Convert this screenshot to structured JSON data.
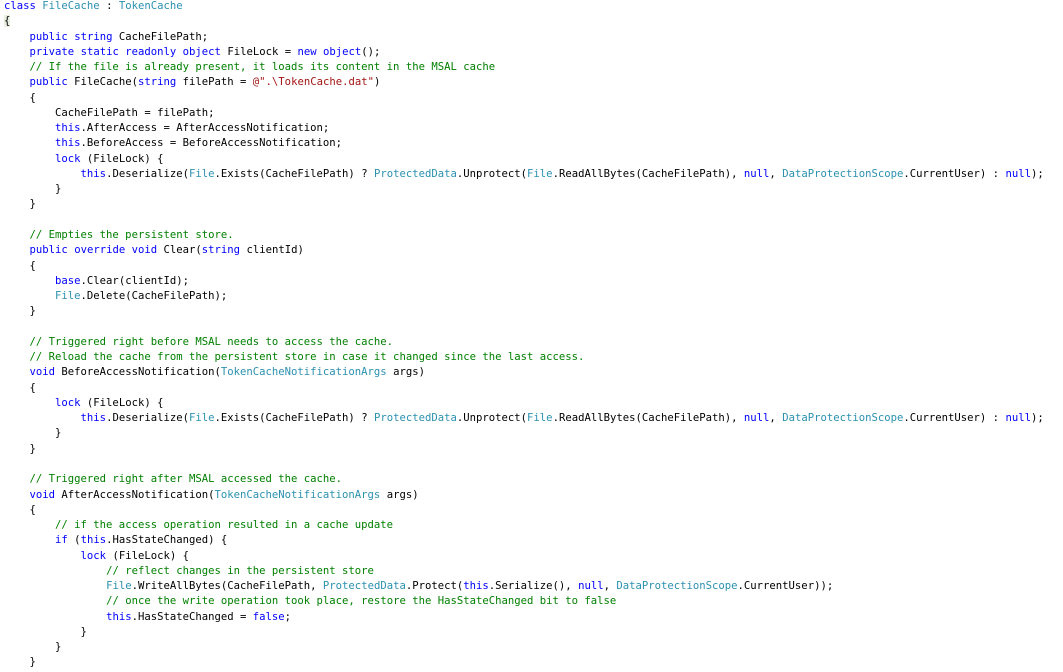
{
  "colors": {
    "keyword": "#0000ff",
    "type": "#2b91af",
    "comment": "#008000",
    "string": "#a31515",
    "text": "#000000"
  },
  "code": {
    "lines": [
      [
        [
          "kw",
          "class"
        ],
        [
          "p",
          " "
        ],
        [
          "type",
          "FileCache"
        ],
        [
          "p",
          " : "
        ],
        [
          "type",
          "TokenCache"
        ]
      ],
      [
        [
          "p",
          "{"
        ]
      ],
      [
        [
          "p",
          "    "
        ],
        [
          "kw",
          "public"
        ],
        [
          "p",
          " "
        ],
        [
          "kw",
          "string"
        ],
        [
          "p",
          " CacheFilePath;"
        ]
      ],
      [
        [
          "p",
          "    "
        ],
        [
          "kw",
          "private"
        ],
        [
          "p",
          " "
        ],
        [
          "kw",
          "static"
        ],
        [
          "p",
          " "
        ],
        [
          "kw",
          "readonly"
        ],
        [
          "p",
          " "
        ],
        [
          "kw",
          "object"
        ],
        [
          "p",
          " FileLock = "
        ],
        [
          "kw",
          "new"
        ],
        [
          "p",
          " "
        ],
        [
          "kw",
          "object"
        ],
        [
          "p",
          "();"
        ]
      ],
      [
        [
          "p",
          "    "
        ],
        [
          "cm",
          "// If the file is already present, it loads its content in the MSAL cache"
        ]
      ],
      [
        [
          "p",
          "    "
        ],
        [
          "kw",
          "public"
        ],
        [
          "p",
          " FileCache("
        ],
        [
          "kw",
          "string"
        ],
        [
          "p",
          " filePath = "
        ],
        [
          "str",
          "@\".\\TokenCache.dat\""
        ],
        [
          "p",
          ")"
        ]
      ],
      [
        [
          "p",
          "    {"
        ]
      ],
      [
        [
          "p",
          "        CacheFilePath = filePath;"
        ]
      ],
      [
        [
          "p",
          "        "
        ],
        [
          "kw",
          "this"
        ],
        [
          "p",
          ".AfterAccess = AfterAccessNotification;"
        ]
      ],
      [
        [
          "p",
          "        "
        ],
        [
          "kw",
          "this"
        ],
        [
          "p",
          ".BeforeAccess = BeforeAccessNotification;"
        ]
      ],
      [
        [
          "p",
          "        "
        ],
        [
          "kw",
          "lock"
        ],
        [
          "p",
          " (FileLock) {"
        ]
      ],
      [
        [
          "p",
          "            "
        ],
        [
          "kw",
          "this"
        ],
        [
          "p",
          ".Deserialize("
        ],
        [
          "type",
          "File"
        ],
        [
          "p",
          ".Exists(CacheFilePath) ? "
        ],
        [
          "type",
          "ProtectedData"
        ],
        [
          "p",
          ".Unprotect("
        ],
        [
          "type",
          "File"
        ],
        [
          "p",
          ".ReadAllBytes(CacheFilePath), "
        ],
        [
          "kw",
          "null"
        ],
        [
          "p",
          ", "
        ],
        [
          "type",
          "DataProtectionScope"
        ],
        [
          "p",
          ".CurrentUser) : "
        ],
        [
          "kw",
          "null"
        ],
        [
          "p",
          ");"
        ]
      ],
      [
        [
          "p",
          "        }"
        ]
      ],
      [
        [
          "p",
          "    }"
        ]
      ],
      [],
      [
        [
          "p",
          "    "
        ],
        [
          "cm",
          "// Empties the persistent store."
        ]
      ],
      [
        [
          "p",
          "    "
        ],
        [
          "kw",
          "public"
        ],
        [
          "p",
          " "
        ],
        [
          "kw",
          "override"
        ],
        [
          "p",
          " "
        ],
        [
          "kw",
          "void"
        ],
        [
          "p",
          " Clear("
        ],
        [
          "kw",
          "string"
        ],
        [
          "p",
          " clientId)"
        ]
      ],
      [
        [
          "p",
          "    {"
        ]
      ],
      [
        [
          "p",
          "        "
        ],
        [
          "kw",
          "base"
        ],
        [
          "p",
          ".Clear(clientId);"
        ]
      ],
      [
        [
          "p",
          "        "
        ],
        [
          "type",
          "File"
        ],
        [
          "p",
          ".Delete(CacheFilePath);"
        ]
      ],
      [
        [
          "p",
          "    }"
        ]
      ],
      [],
      [
        [
          "p",
          "    "
        ],
        [
          "cm",
          "// Triggered right before MSAL needs to access the cache."
        ]
      ],
      [
        [
          "p",
          "    "
        ],
        [
          "cm",
          "// Reload the cache from the persistent store in case it changed since the last access."
        ]
      ],
      [
        [
          "p",
          "    "
        ],
        [
          "kw",
          "void"
        ],
        [
          "p",
          " BeforeAccessNotification("
        ],
        [
          "type",
          "TokenCacheNotificationArgs"
        ],
        [
          "p",
          " args)"
        ]
      ],
      [
        [
          "p",
          "    {"
        ]
      ],
      [
        [
          "p",
          "        "
        ],
        [
          "kw",
          "lock"
        ],
        [
          "p",
          " (FileLock) {"
        ]
      ],
      [
        [
          "p",
          "            "
        ],
        [
          "kw",
          "this"
        ],
        [
          "p",
          ".Deserialize("
        ],
        [
          "type",
          "File"
        ],
        [
          "p",
          ".Exists(CacheFilePath) ? "
        ],
        [
          "type",
          "ProtectedData"
        ],
        [
          "p",
          ".Unprotect("
        ],
        [
          "type",
          "File"
        ],
        [
          "p",
          ".ReadAllBytes(CacheFilePath), "
        ],
        [
          "kw",
          "null"
        ],
        [
          "p",
          ", "
        ],
        [
          "type",
          "DataProtectionScope"
        ],
        [
          "p",
          ".CurrentUser) : "
        ],
        [
          "kw",
          "null"
        ],
        [
          "p",
          ");"
        ]
      ],
      [
        [
          "p",
          "        }"
        ]
      ],
      [
        [
          "p",
          "    }"
        ]
      ],
      [],
      [
        [
          "p",
          "    "
        ],
        [
          "cm",
          "// Triggered right after MSAL accessed the cache."
        ]
      ],
      [
        [
          "p",
          "    "
        ],
        [
          "kw",
          "void"
        ],
        [
          "p",
          " AfterAccessNotification("
        ],
        [
          "type",
          "TokenCacheNotificationArgs"
        ],
        [
          "p",
          " args)"
        ]
      ],
      [
        [
          "p",
          "    {"
        ]
      ],
      [
        [
          "p",
          "        "
        ],
        [
          "cm",
          "// if the access operation resulted in a cache update"
        ]
      ],
      [
        [
          "p",
          "        "
        ],
        [
          "kw",
          "if"
        ],
        [
          "p",
          " ("
        ],
        [
          "kw",
          "this"
        ],
        [
          "p",
          ".HasStateChanged) {"
        ]
      ],
      [
        [
          "p",
          "            "
        ],
        [
          "kw",
          "lock"
        ],
        [
          "p",
          " (FileLock) {"
        ]
      ],
      [
        [
          "p",
          "                "
        ],
        [
          "cm",
          "// reflect changes in the persistent store"
        ]
      ],
      [
        [
          "p",
          "                "
        ],
        [
          "type",
          "File"
        ],
        [
          "p",
          ".WriteAllBytes(CacheFilePath, "
        ],
        [
          "type",
          "ProtectedData"
        ],
        [
          "p",
          ".Protect("
        ],
        [
          "kw",
          "this"
        ],
        [
          "p",
          ".Serialize(), "
        ],
        [
          "kw",
          "null"
        ],
        [
          "p",
          ", "
        ],
        [
          "type",
          "DataProtectionScope"
        ],
        [
          "p",
          ".CurrentUser));"
        ]
      ],
      [
        [
          "p",
          "                "
        ],
        [
          "cm",
          "// once the write operation took place, restore the HasStateChanged bit to false"
        ]
      ],
      [
        [
          "p",
          "                "
        ],
        [
          "kw",
          "this"
        ],
        [
          "p",
          ".HasStateChanged = "
        ],
        [
          "kw",
          "false"
        ],
        [
          "p",
          ";"
        ]
      ],
      [
        [
          "p",
          "            }"
        ]
      ],
      [
        [
          "p",
          "        }"
        ]
      ],
      [
        [
          "p",
          "    }"
        ]
      ]
    ]
  }
}
